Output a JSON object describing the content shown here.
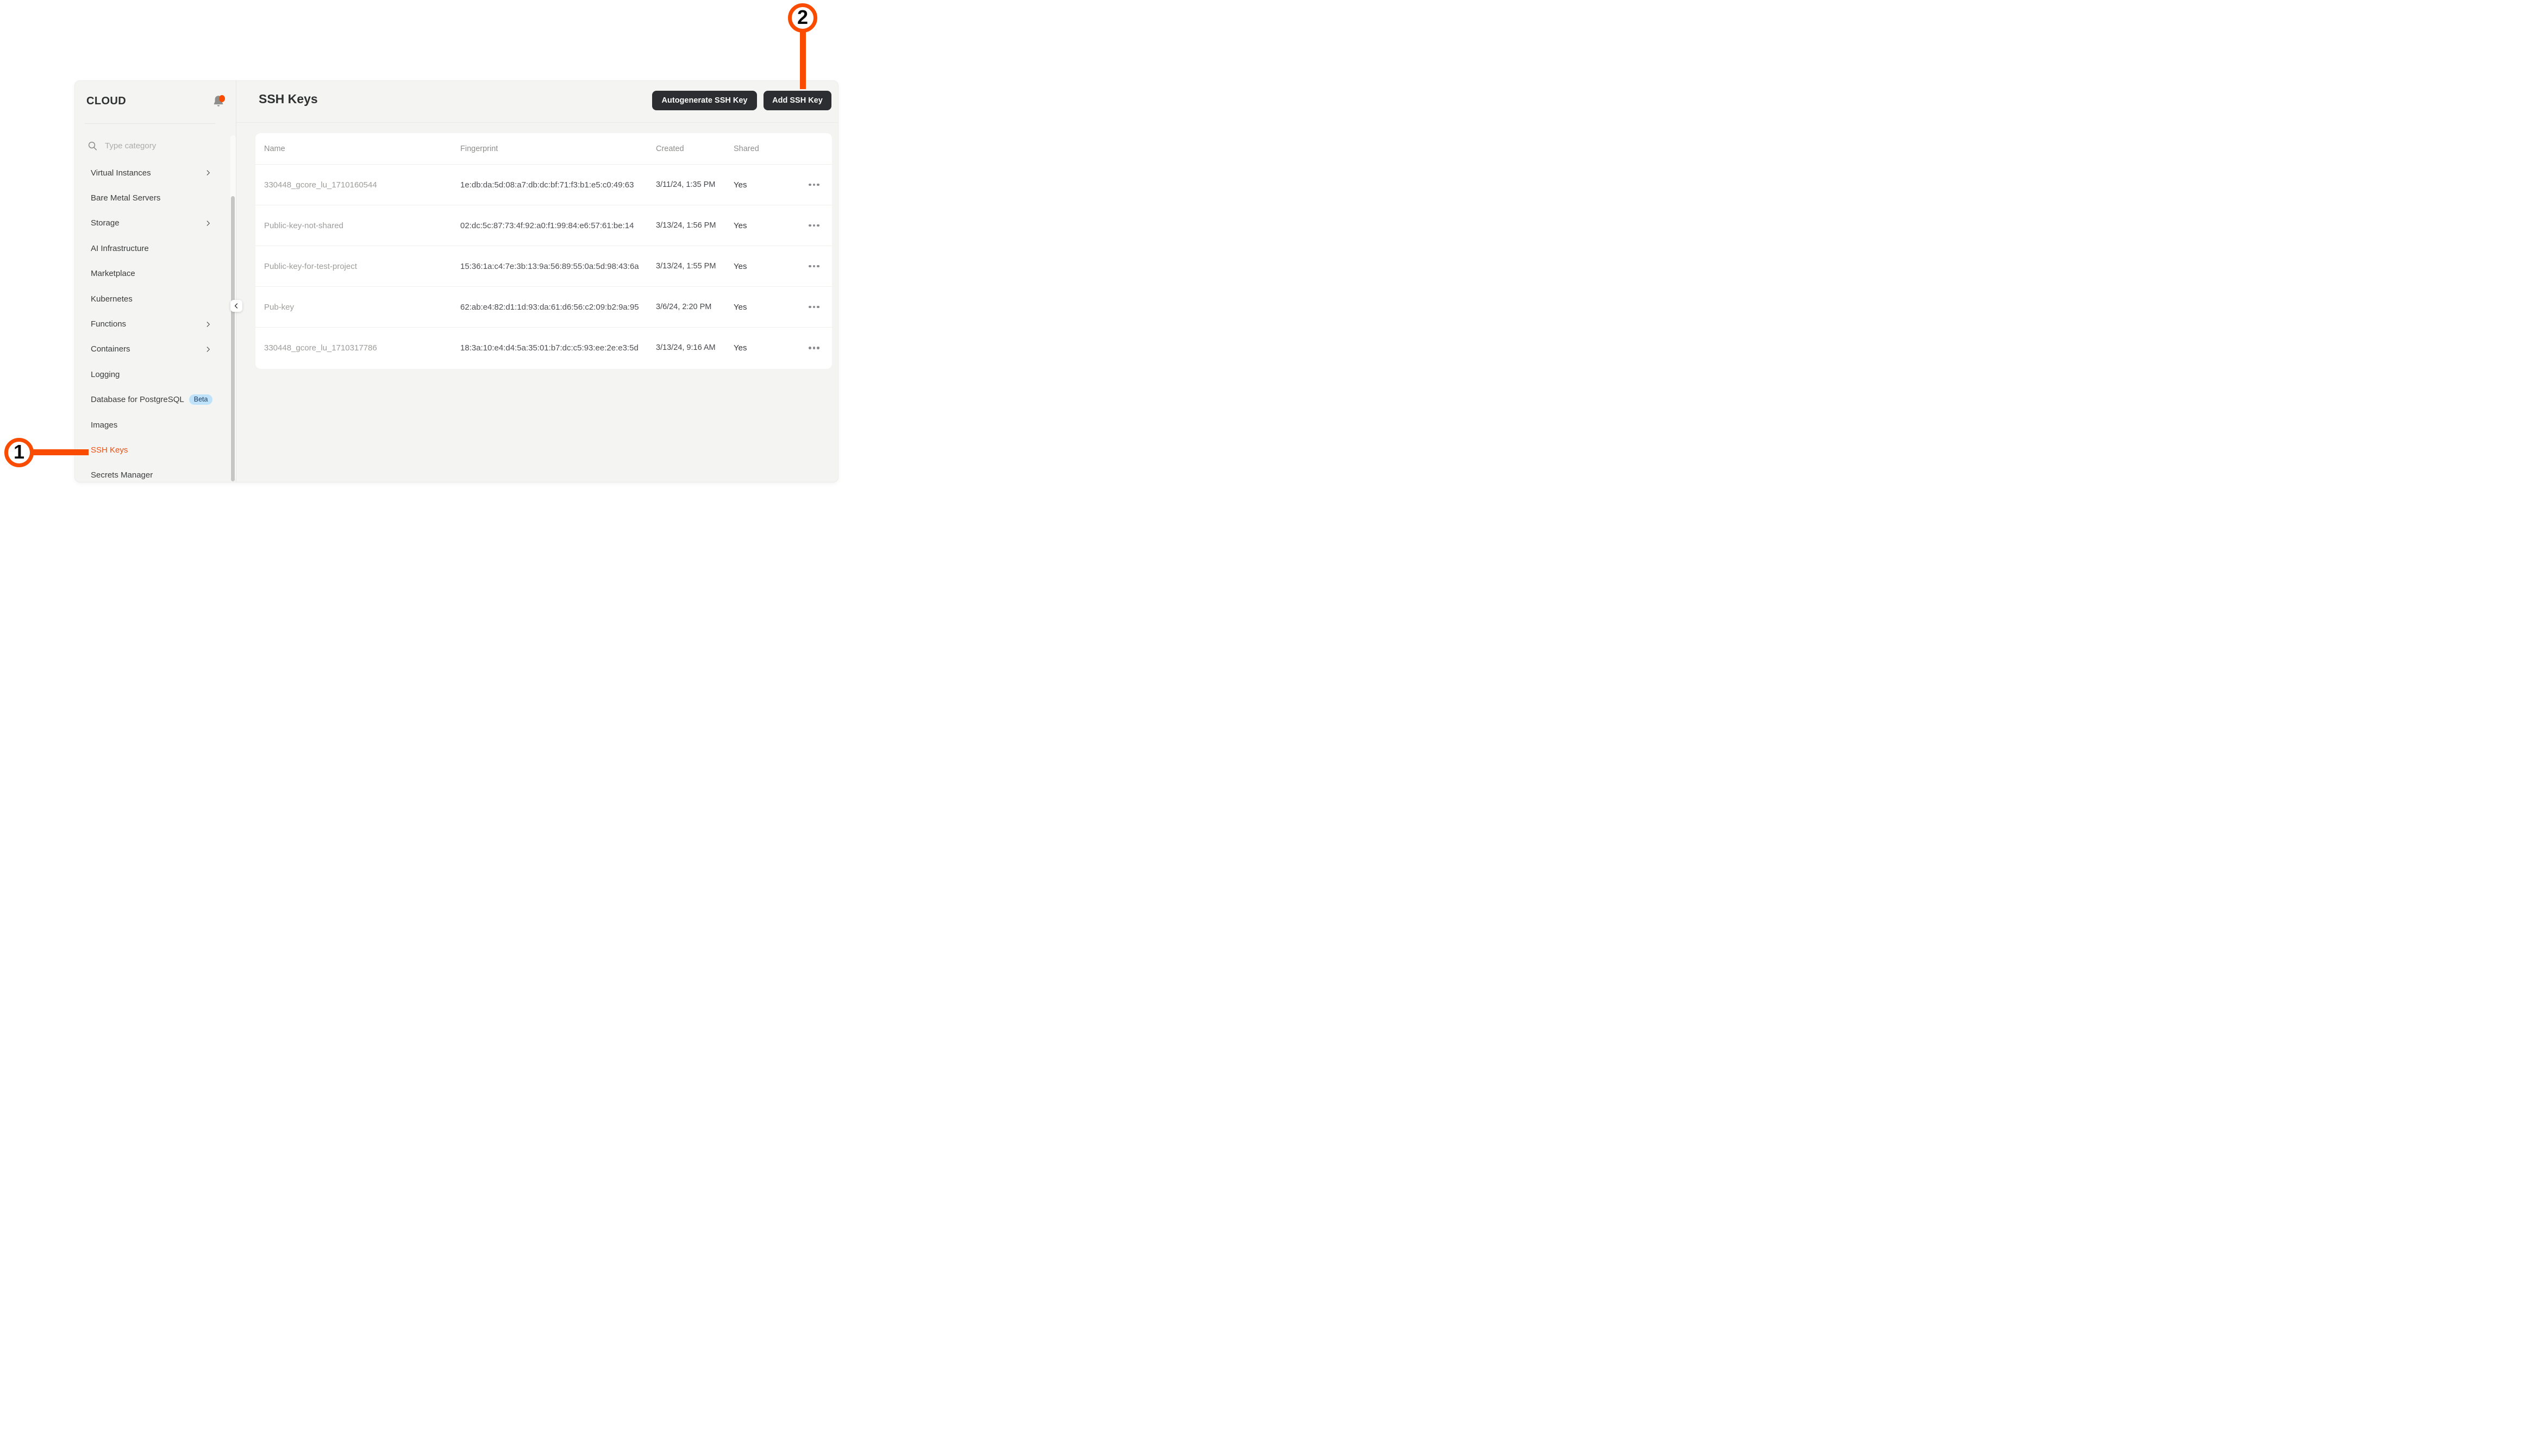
{
  "sidebar": {
    "title": "CLOUD",
    "search_placeholder": "Type category",
    "items": [
      {
        "label": "Virtual Instances",
        "has_submenu": true
      },
      {
        "label": "Bare Metal Servers",
        "has_submenu": false
      },
      {
        "label": "Storage",
        "has_submenu": true
      },
      {
        "label": "AI Infrastructure",
        "has_submenu": false
      },
      {
        "label": "Marketplace",
        "has_submenu": false
      },
      {
        "label": "Kubernetes",
        "has_submenu": false
      },
      {
        "label": "Functions",
        "has_submenu": true
      },
      {
        "label": "Containers",
        "has_submenu": true
      },
      {
        "label": "Logging",
        "has_submenu": false
      },
      {
        "label": "Database for PostgreSQL",
        "has_submenu": false,
        "badge": "Beta"
      },
      {
        "label": "Images",
        "has_submenu": false
      },
      {
        "label": "SSH Keys",
        "has_submenu": false,
        "active": true
      },
      {
        "label": "Secrets Manager",
        "has_submenu": false
      }
    ]
  },
  "header": {
    "title": "SSH Keys",
    "autogenerate_button": "Autogenerate SSH Key",
    "add_button": "Add SSH Key"
  },
  "table": {
    "columns": {
      "name": "Name",
      "fingerprint": "Fingerprint",
      "created": "Created",
      "shared": "Shared"
    },
    "rows": [
      {
        "name": "330448_gcore_lu_1710160544",
        "fingerprint": "1e:db:da:5d:08:a7:db:dc:bf:71:f3:b1:e5:c0:49:63",
        "created": "3/11/24, 1:35 PM",
        "shared": "Yes"
      },
      {
        "name": "Public-key-not-shared",
        "fingerprint": "02:dc:5c:87:73:4f:92:a0:f1:99:84:e6:57:61:be:14",
        "created": "3/13/24, 1:56 PM",
        "shared": "Yes"
      },
      {
        "name": "Public-key-for-test-project",
        "fingerprint": "15:36:1a:c4:7e:3b:13:9a:56:89:55:0a:5d:98:43:6a",
        "created": "3/13/24, 1:55 PM",
        "shared": "Yes"
      },
      {
        "name": "Pub-key",
        "fingerprint": "62:ab:e4:82:d1:1d:93:da:61:d6:56:c2:09:b2:9a:95",
        "created": "3/6/24, 2:20 PM",
        "shared": "Yes"
      },
      {
        "name": "330448_gcore_lu_1710317786",
        "fingerprint": "18:3a:10:e4:d4:5a:35:01:b7:dc:c5:93:ee:2e:e3:5d",
        "created": "3/13/24, 9:16 AM",
        "shared": "Yes"
      }
    ]
  },
  "annotations": {
    "step1": "1",
    "step2": "2"
  },
  "icons": {
    "bell": "notification-bell with orange unread dot",
    "search": "magnifier",
    "chevron_right": "submenu expand arrow",
    "chevron_left": "collapse sidebar",
    "ellipsis": "row actions menu"
  },
  "colors": {
    "accent_orange": "#F94C00",
    "active_item_orange": "#F24E0E",
    "button_dark": "#2D2E31",
    "panel_bg": "#F4F4F2",
    "badge_bg": "#BEE2FA",
    "badge_text": "#1C3A5E"
  }
}
